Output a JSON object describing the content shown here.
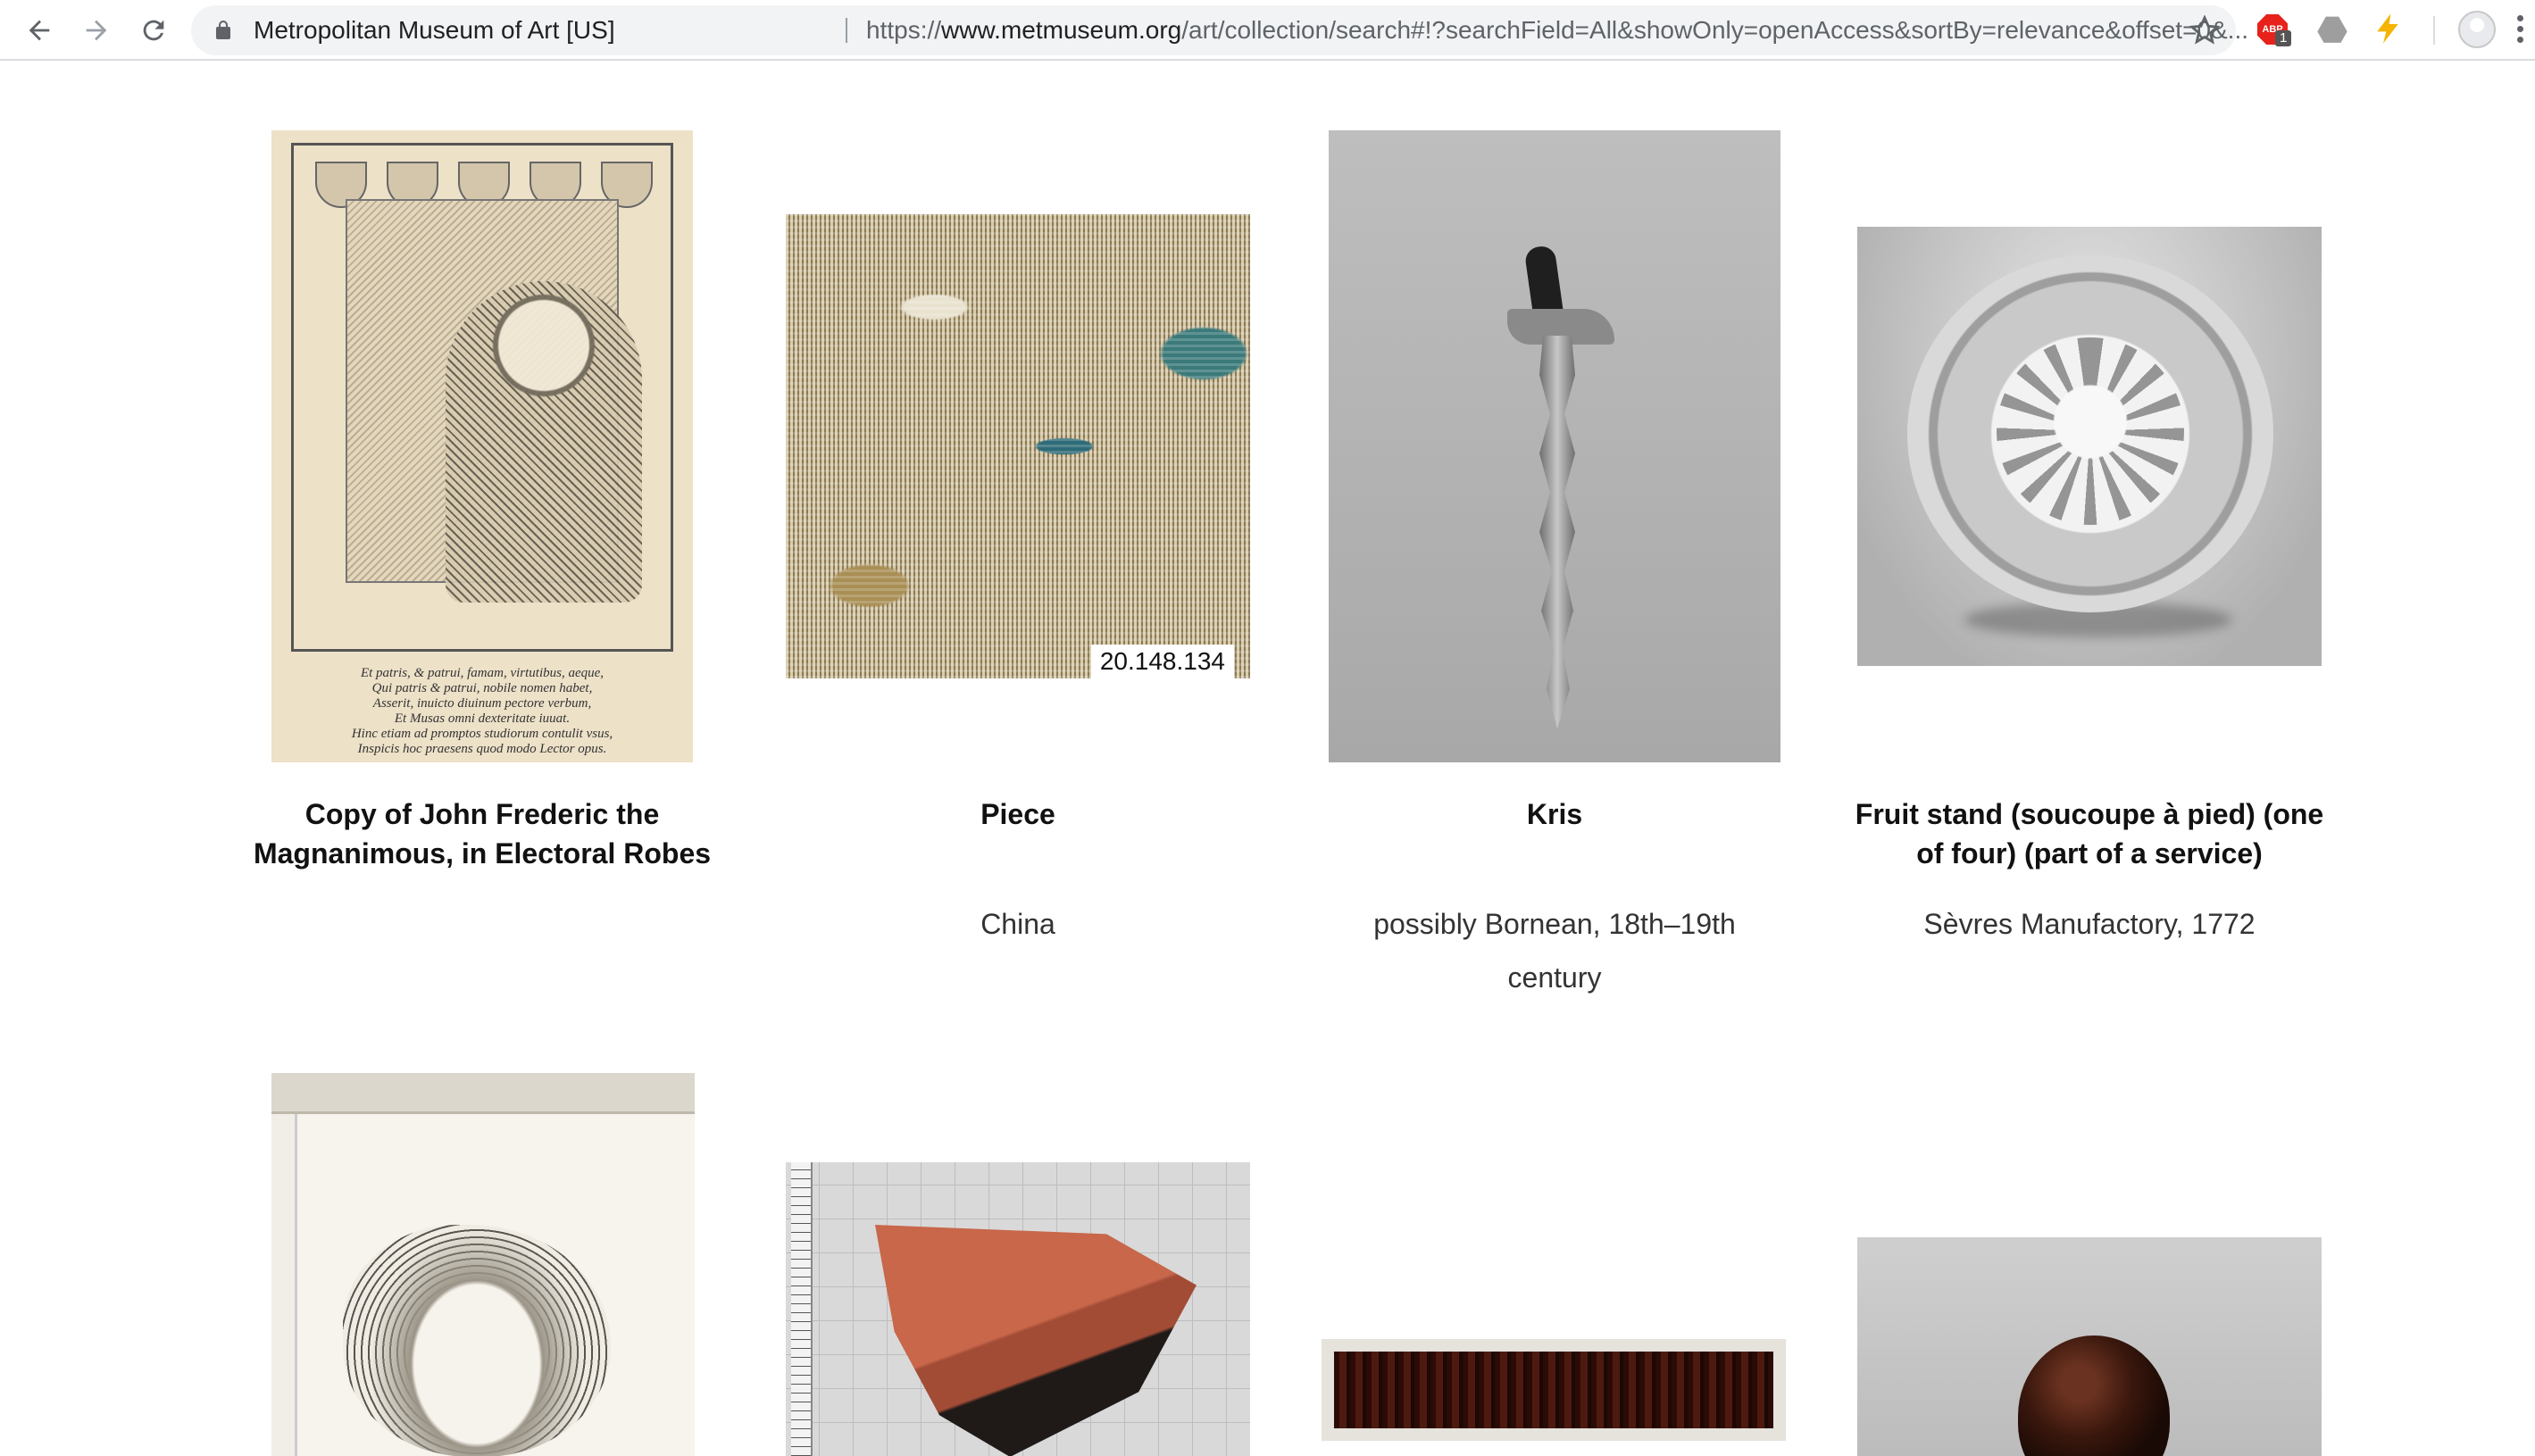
{
  "browser": {
    "site_name": "Metropolitan Museum of Art [US]",
    "url_scheme": "https://",
    "url_host": "www.metmuseum.org",
    "url_path": "/art/collection/search#!?searchField=All&showOnly=openAccess&sortBy=relevance&offset=0&...",
    "extensions": {
      "adblock_label": "ABP",
      "adblock_badge": "1"
    }
  },
  "artworks": [
    {
      "title": "Copy of John Frederic the Magnanimous, in Electoral Robes",
      "meta": "",
      "verse": "Et patris, & patrui, famam, virtutibus, aeque,\nQui patris & patrui, nobile nomen habet,\nAsserit, inuicto diuinum pectore verbum,\nEt Musas omni dexteritate iuuat.\nHinc etiam ad promptos studiorum contulit vsus,\nInspicis hoc praesens quod modo Lector opus."
    },
    {
      "title": "Piece",
      "meta": "China",
      "accession": "20.148.134"
    },
    {
      "title": "Kris",
      "meta": "possibly Bornean, 18th–19th century"
    },
    {
      "title": "Fruit stand (soucoupe à pied) (one of four) (part of a service)",
      "meta": "Sèvres Manufactory, 1772"
    },
    {
      "title": "",
      "meta": ""
    },
    {
      "title": "",
      "meta": ""
    },
    {
      "title": "",
      "meta": ""
    },
    {
      "title": "",
      "meta": ""
    }
  ]
}
